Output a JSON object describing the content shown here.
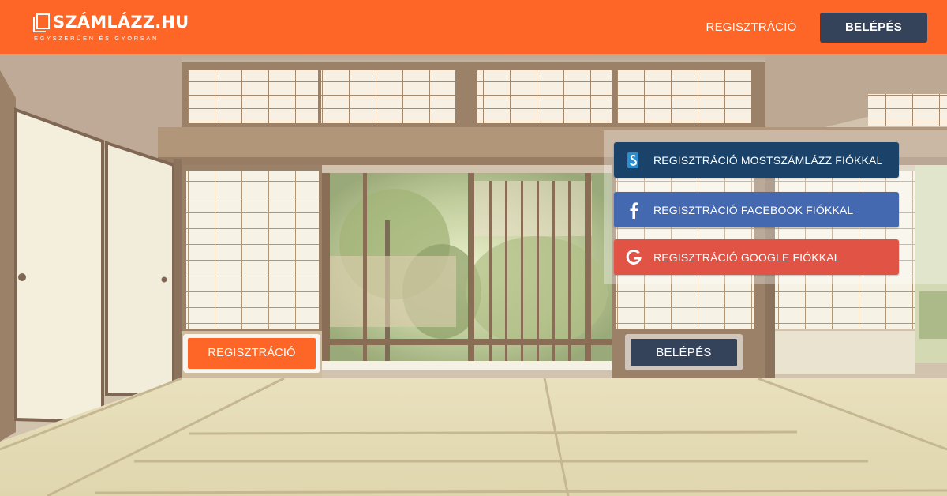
{
  "header": {
    "logo_text": "SZÁMLÁZZ.HU",
    "logo_slogan": "EGYSZERŰEN ÉS GYORSAN",
    "register_link": "REGISZTRÁCIÓ",
    "login_button": "BELÉPÉS"
  },
  "signup_panel": {
    "szamlazz_label": "REGISZTRÁCIÓ MOSTSZÁMLÁZZ FIÓKKAL",
    "facebook_label": "REGISZTRÁCIÓ FACEBOOK FIÓKKAL",
    "google_label": "REGISZTRÁCIÓ GOOGLE FIÓKKAL"
  },
  "cta": {
    "register": "REGISZTRÁCIÓ",
    "login": "BELÉPÉS"
  },
  "icons": {
    "szamlazz": "szamlazz-s-icon",
    "facebook": "facebook-f-icon",
    "google": "google-g-icon"
  },
  "colors": {
    "brand_orange": "#fe6627",
    "navy": "#34425a",
    "szamlazz_blue": "#1b4369",
    "facebook_blue": "#4569b0",
    "google_red": "#e15344"
  }
}
